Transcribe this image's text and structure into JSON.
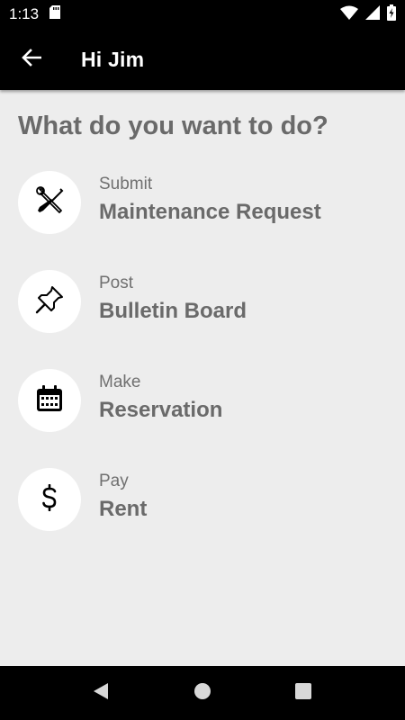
{
  "status_bar": {
    "time": "1:13"
  },
  "app_bar": {
    "title": "Hi Jim"
  },
  "main": {
    "heading": "What do you want to do?",
    "actions": [
      {
        "subtitle": "Submit",
        "title": "Maintenance Request",
        "icon": "tools-icon"
      },
      {
        "subtitle": "Post",
        "title": "Bulletin Board",
        "icon": "pushpin-icon"
      },
      {
        "subtitle": "Make",
        "title": "Reservation",
        "icon": "calendar-icon"
      },
      {
        "subtitle": "Pay",
        "title": "Rent",
        "icon": "dollar-icon"
      }
    ]
  },
  "colors": {
    "bar_background": "#000000",
    "page_background": "#ededed",
    "text_gray": "#6a6a6a",
    "icon_circle": "#ffffff"
  }
}
